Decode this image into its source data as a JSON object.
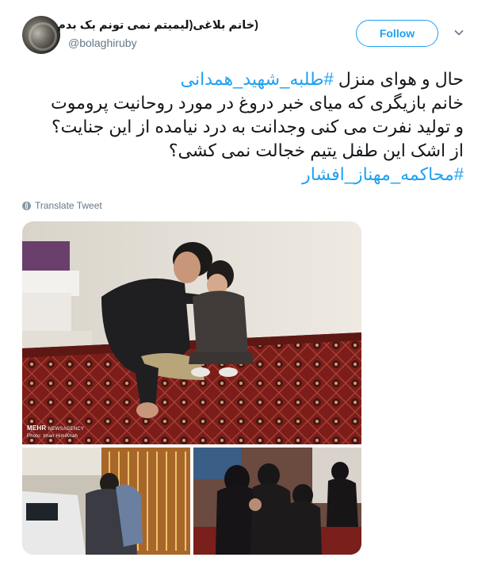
{
  "author": {
    "display_name": "(خانم بلاغی(لیمیتم نمی تونم بک بدم",
    "handle": "@bolaghiruby"
  },
  "follow_label": "Follow",
  "tweet": {
    "lines": [
      {
        "text": "حال و هوای منزل ",
        "hashtag": "#طلبه_شهید_همدانی"
      },
      {
        "text": "خانم بازیگری که میای خبر دروغ در مورد روحانیت پروموت"
      },
      {
        "text": "و تولید نفرت می کنی وجدانت به درد نیامده از این جنایت؟"
      },
      {
        "text": "از اشک این طفل یتیم خجالت نمی کشی؟"
      },
      {
        "text": "",
        "hashtag": "#محاکمه_مهناز_افشار"
      }
    ]
  },
  "translate_label": "Translate Tweet",
  "media": {
    "watermark_brand": "MEHR",
    "watermark_agency": "NEWSAGENCY",
    "photo_credit": "Photo: Iman HimiKhah"
  },
  "colors": {
    "accent": "#1da1f2",
    "secondary_text": "#657786",
    "primary_text": "#14171a"
  }
}
